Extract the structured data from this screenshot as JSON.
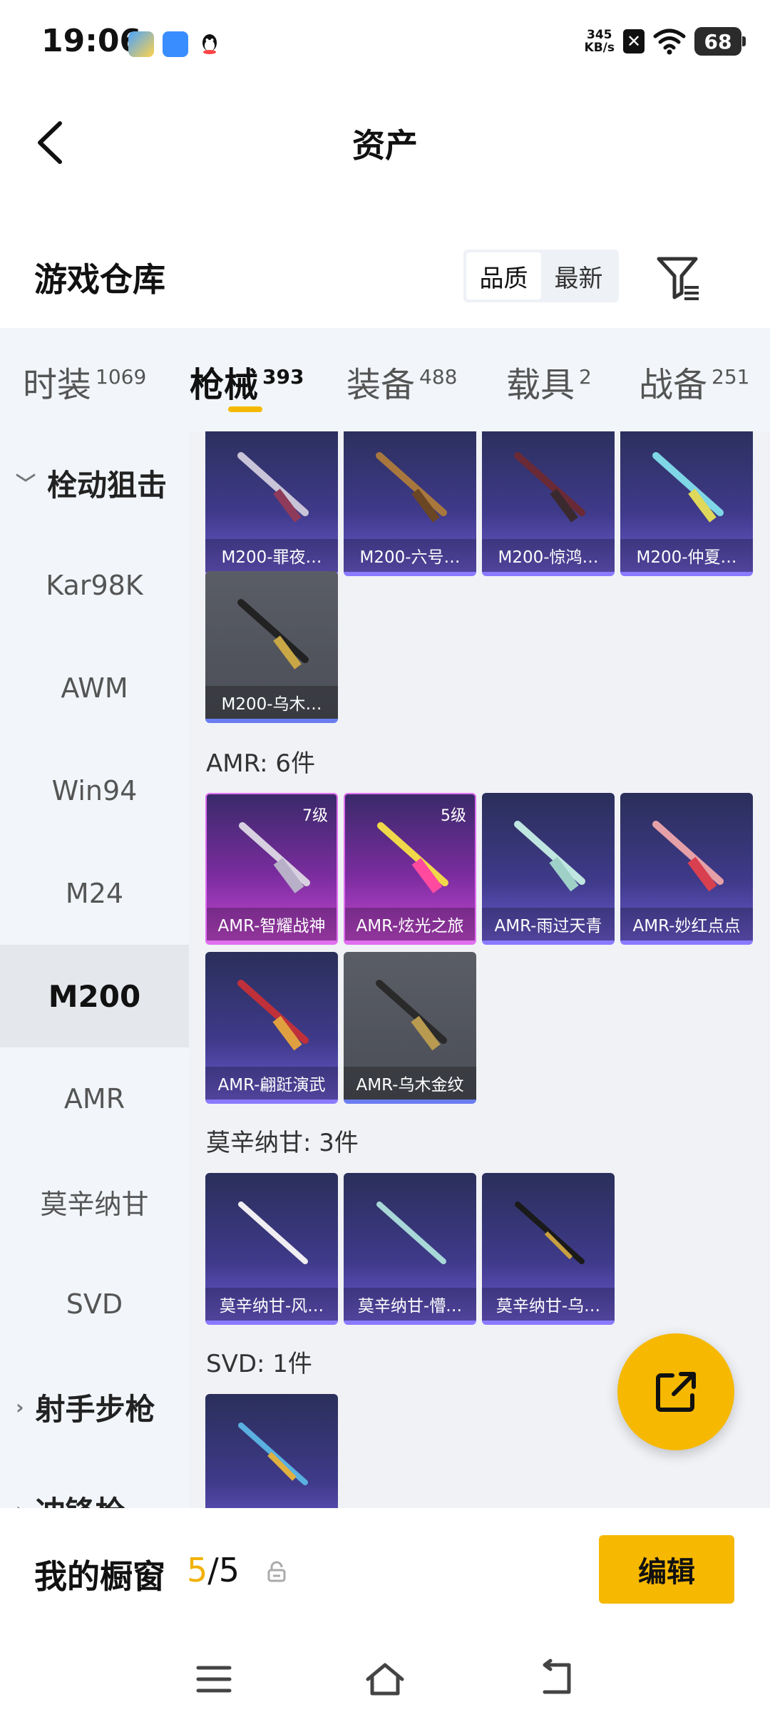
{
  "status_bar": {
    "time": "19:06",
    "net_speed_value": "345",
    "net_speed_unit": "KB/s",
    "sim_icon": "x-icon",
    "battery": "68"
  },
  "header": {
    "title": "资产"
  },
  "section": {
    "title": "游戏仓库",
    "sort_options": [
      "品质",
      "最新"
    ],
    "sort_selected": "品质"
  },
  "tabs": [
    {
      "label": "时装",
      "count": "1069"
    },
    {
      "label": "枪械",
      "count": "393",
      "active": true
    },
    {
      "label": "装备",
      "count": "488"
    },
    {
      "label": "载具",
      "count": "2"
    },
    {
      "label": "战备",
      "count": "251"
    }
  ],
  "sidebar": {
    "items": [
      {
        "label": "栓动狙击",
        "type": "group",
        "expanded": true
      },
      {
        "label": "Kar98K"
      },
      {
        "label": "AWM"
      },
      {
        "label": "Win94"
      },
      {
        "label": "M24"
      },
      {
        "label": "M200",
        "selected": true
      },
      {
        "label": "AMR"
      },
      {
        "label": "莫辛纳甘"
      },
      {
        "label": "SVD"
      },
      {
        "label": "射手步枪",
        "type": "group",
        "expanded": false
      },
      {
        "label": "冲锋枪",
        "type": "group",
        "expanded": false
      }
    ]
  },
  "content": {
    "m200_items": [
      "M200-罪夜…",
      "M200-六号…",
      "M200-惊鸿…",
      "M200-仲夏…",
      "M200-乌木…"
    ],
    "amr_title": "AMR: 6件",
    "amr_items": [
      {
        "name": "AMR-智耀战神",
        "level": "7级"
      },
      {
        "name": "AMR-炫光之旅",
        "level": "5级"
      },
      {
        "name": "AMR-雨过天青"
      },
      {
        "name": "AMR-妙红点点"
      },
      {
        "name": "AMR-翩跹演武"
      },
      {
        "name": "AMR-乌木金纹"
      }
    ],
    "mosin_title": "莫辛纳甘: 3件",
    "mosin_items": [
      "莫辛纳甘-风…",
      "莫辛纳甘-懵…",
      "莫辛纳甘-乌…"
    ],
    "svd_title": "SVD: 1件"
  },
  "bottom": {
    "label": "我的橱窗",
    "count_current": "5",
    "count_sep": "/",
    "count_total": "5",
    "edit_label": "编辑"
  }
}
